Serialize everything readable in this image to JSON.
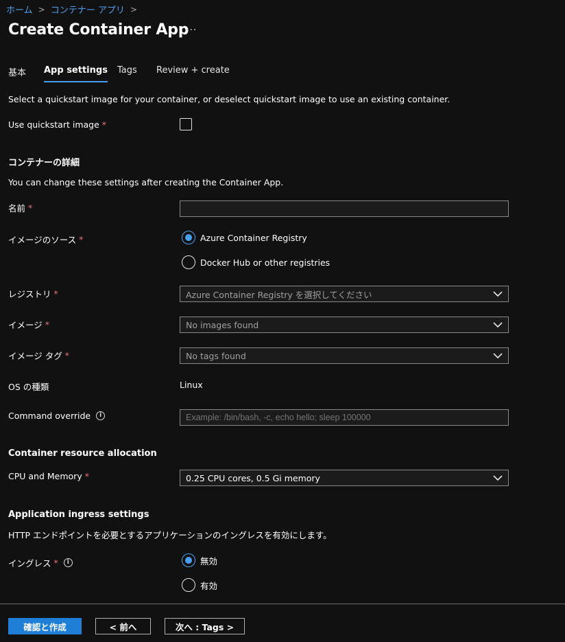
{
  "breadcrumb": {
    "home": "ホーム",
    "container_apps": "コンテナー アプリ"
  },
  "page": {
    "title": "Create Container App",
    "more": "···"
  },
  "tabs": [
    {
      "label": "基本"
    },
    {
      "label": "App settings"
    },
    {
      "label": "Tags"
    },
    {
      "label": "Review + create"
    }
  ],
  "quickstart": {
    "description": "Select a quickstart image for your container, or deselect quickstart image to use an existing container.",
    "label": "Use quickstart image",
    "required": "*"
  },
  "details": {
    "heading": "コンテナーの詳細",
    "description": "You can change these settings after creating the Container App.",
    "name_label": "名前",
    "name_value": "",
    "image_source_label": "イメージのソース",
    "image_source_options": [
      "Azure Container Registry",
      "Docker Hub or other registries"
    ],
    "registry_label": "レジストリ",
    "registry_placeholder": "Azure Container Registry を選択してください",
    "image_label": "イメージ",
    "image_placeholder": "No images found",
    "image_tag_label": "イメージ タグ",
    "image_tag_placeholder": "No tags found",
    "os_label": "OS の種類",
    "os_value": "Linux",
    "command_label": "Command override",
    "command_placeholder": "Example: /bin/bash, -c, echo hello; sleep 100000",
    "info_glyph": "i"
  },
  "resources": {
    "heading": "Container resource allocation",
    "cpu_label": "CPU and Memory",
    "cpu_value": "0.25 CPU cores, 0.5 Gi memory"
  },
  "ingress": {
    "heading": "Application ingress settings",
    "description": "HTTP エンドポイントを必要とするアプリケーションのイングレスを有効にします。",
    "label": "イングレス",
    "options": [
      "無効",
      "有効"
    ]
  },
  "footer": {
    "review_create": "確認と作成",
    "previous": "< 前へ",
    "next": "次へ : Tags >"
  },
  "colors": {
    "accent": "#4aa0f0",
    "primary_button": "#1f7fd6",
    "required": "#f1707b",
    "background": "#111111"
  }
}
